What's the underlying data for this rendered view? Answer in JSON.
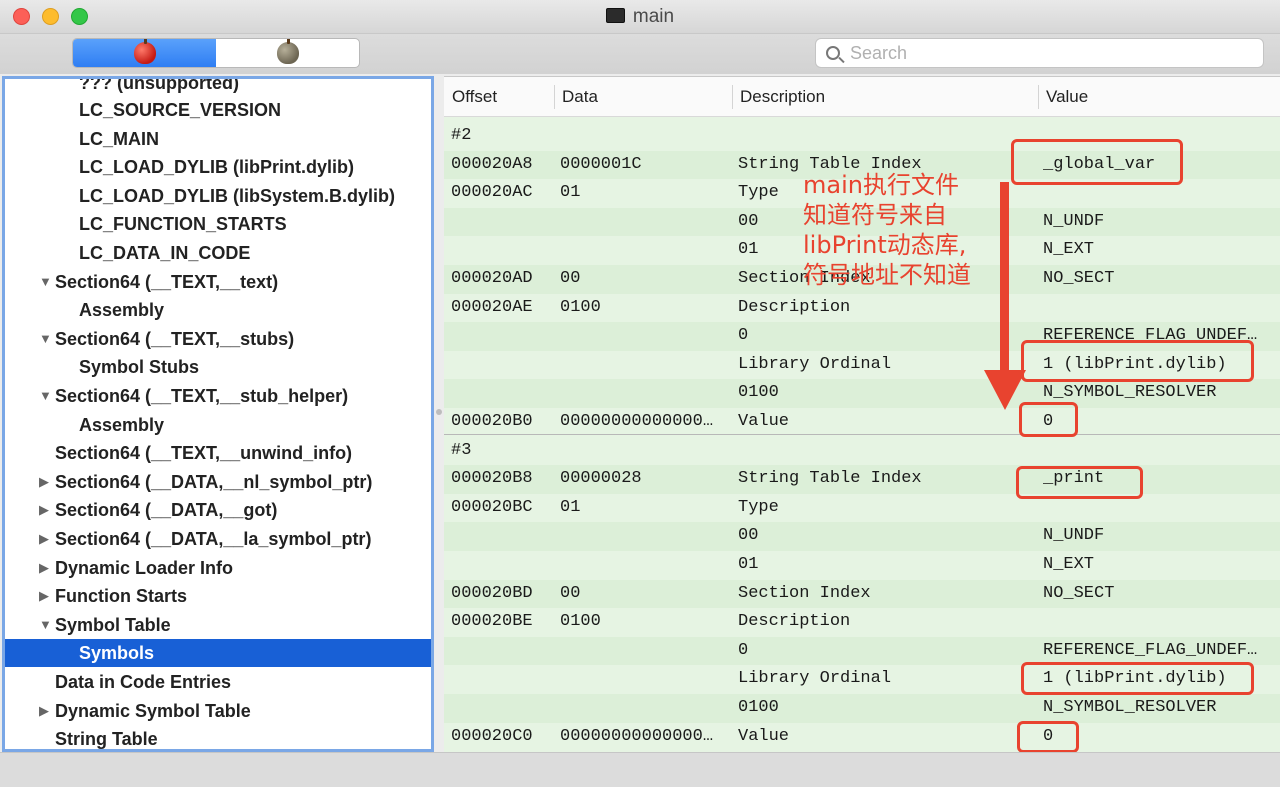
{
  "window": {
    "title": "main"
  },
  "toolbar": {
    "search_placeholder": "Search",
    "segment_left_icon": "apple-red-icon",
    "segment_right_icon": "apple-gray-icon"
  },
  "sidebar": {
    "items": [
      {
        "label": "??? (unsupported)",
        "level": 2
      },
      {
        "label": "LC_SOURCE_VERSION",
        "level": 2
      },
      {
        "label": "LC_MAIN",
        "level": 2
      },
      {
        "label": "LC_LOAD_DYLIB (libPrint.dylib)",
        "level": 2
      },
      {
        "label": "LC_LOAD_DYLIB (libSystem.B.dylib)",
        "level": 2
      },
      {
        "label": "LC_FUNCTION_STARTS",
        "level": 2
      },
      {
        "label": "LC_DATA_IN_CODE",
        "level": 2
      },
      {
        "label": "Section64 (__TEXT,__text)",
        "level": 1,
        "disclosure": "▼"
      },
      {
        "label": "Assembly",
        "level": 2
      },
      {
        "label": "Section64 (__TEXT,__stubs)",
        "level": 1,
        "disclosure": "▼"
      },
      {
        "label": "Symbol Stubs",
        "level": 2
      },
      {
        "label": "Section64 (__TEXT,__stub_helper)",
        "level": 1,
        "disclosure": "▼"
      },
      {
        "label": "Assembly",
        "level": 2
      },
      {
        "label": "Section64 (__TEXT,__unwind_info)",
        "level": 1
      },
      {
        "label": "Section64 (__DATA,__nl_symbol_ptr)",
        "level": 1,
        "disclosure": "▶"
      },
      {
        "label": "Section64 (__DATA,__got)",
        "level": 1,
        "disclosure": "▶"
      },
      {
        "label": "Section64 (__DATA,__la_symbol_ptr)",
        "level": 1,
        "disclosure": "▶"
      },
      {
        "label": "Dynamic Loader Info",
        "level": 1,
        "disclosure": "▶"
      },
      {
        "label": "Function Starts",
        "level": 1,
        "disclosure": "▶"
      },
      {
        "label": "Symbol Table",
        "level": 1,
        "disclosure": "▼"
      },
      {
        "label": "Symbols",
        "level": 2,
        "selected": true
      },
      {
        "label": "Data in Code Entries",
        "level": 1
      },
      {
        "label": "Dynamic Symbol Table",
        "level": 1,
        "disclosure": "▶"
      },
      {
        "label": "String Table",
        "level": 1
      }
    ]
  },
  "table": {
    "columns": [
      "Offset",
      "Data",
      "Description",
      "Value"
    ],
    "rows": [
      {
        "offset": "#2",
        "data": "",
        "desc": "",
        "value": ""
      },
      {
        "offset": "000020A8",
        "data": "0000001C",
        "desc": "String Table Index",
        "value": "_global_var"
      },
      {
        "offset": "000020AC",
        "data": "01",
        "desc": "Type",
        "value": ""
      },
      {
        "offset": "",
        "data": "",
        "desc": "00",
        "value": "N_UNDF"
      },
      {
        "offset": "",
        "data": "",
        "desc": "01",
        "value": "N_EXT"
      },
      {
        "offset": "000020AD",
        "data": "00",
        "desc": "Section Index",
        "value": "NO_SECT"
      },
      {
        "offset": "000020AE",
        "data": "0100",
        "desc": "Description",
        "value": ""
      },
      {
        "offset": "",
        "data": "",
        "desc": "0",
        "value": "REFERENCE_FLAG_UNDEF…"
      },
      {
        "offset": "",
        "data": "",
        "desc": "Library Ordinal",
        "value": "1 (libPrint.dylib)"
      },
      {
        "offset": "",
        "data": "",
        "desc": "0100",
        "value": "N_SYMBOL_RESOLVER"
      },
      {
        "offset": "000020B0",
        "data": "00000000000000…",
        "desc": "Value",
        "value": "0"
      },
      {
        "offset": "#3",
        "data": "",
        "desc": "",
        "value": ""
      },
      {
        "offset": "000020B8",
        "data": "00000028",
        "desc": "String Table Index",
        "value": "_print"
      },
      {
        "offset": "000020BC",
        "data": "01",
        "desc": "Type",
        "value": ""
      },
      {
        "offset": "",
        "data": "",
        "desc": "00",
        "value": "N_UNDF"
      },
      {
        "offset": "",
        "data": "",
        "desc": "01",
        "value": "N_EXT"
      },
      {
        "offset": "000020BD",
        "data": "00",
        "desc": "Section Index",
        "value": "NO_SECT"
      },
      {
        "offset": "000020BE",
        "data": "0100",
        "desc": "Description",
        "value": ""
      },
      {
        "offset": "",
        "data": "",
        "desc": "0",
        "value": "REFERENCE_FLAG_UNDEF…"
      },
      {
        "offset": "",
        "data": "",
        "desc": "Library Ordinal",
        "value": "1 (libPrint.dylib)"
      },
      {
        "offset": "",
        "data": "",
        "desc": "0100",
        "value": "N_SYMBOL_RESOLVER"
      },
      {
        "offset": "000020C0",
        "data": "00000000000000…",
        "desc": "Value",
        "value": "0"
      }
    ]
  },
  "annotation": {
    "lines": [
      "main执行文件",
      "知道符号来自",
      "libPrint动态库,",
      "符号地址不知道"
    ],
    "color": "#e8432f"
  },
  "colors": {
    "selection": "#1860d6",
    "table_bg": "#e6f4e3",
    "highlight": "#e8432f"
  }
}
